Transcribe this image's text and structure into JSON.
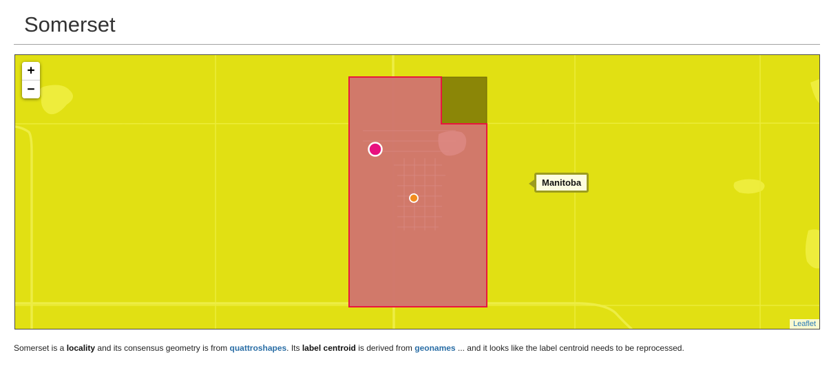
{
  "page": {
    "title": "Somerset"
  },
  "map": {
    "zoom_in_label": "+",
    "zoom_out_label": "−",
    "tooltip_label": "Manitoba",
    "attribution_label": "Leaflet",
    "background_color": "#e1e013",
    "polygon_fill_color": "#d0736f",
    "polygon_stroke_color": "#e8163e",
    "neighbour_fill_color": "#8b8607",
    "label_centroid_color": "#e8127f",
    "geom_centroid_color": "#f28c1e"
  },
  "description": {
    "p1": "Somerset is a ",
    "placetype": "locality",
    "p2": " and its consensus geometry is from ",
    "geom_source": "quattroshapes",
    "p3": ". Its ",
    "label_centroid_term": "label centroid",
    "p4": " is derived from ",
    "label_source": "geonames",
    "p5": " ... and it looks like the label centroid needs to be reprocessed."
  }
}
